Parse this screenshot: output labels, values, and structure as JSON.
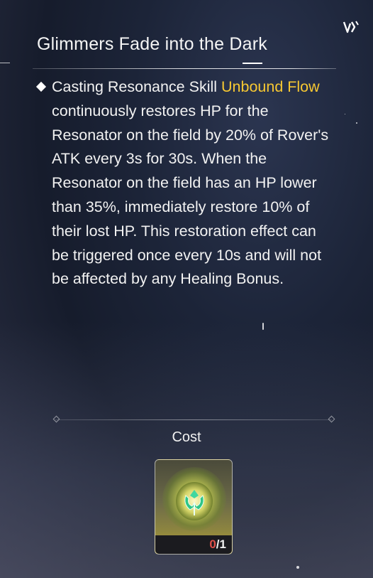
{
  "skill": {
    "title": "Glimmers Fade into the Dark",
    "description_before": "Casting Resonance Skill ",
    "highlight": "Unbound Flow",
    "description_after": " continuously restores HP for the Resonator on the field by 20% of Rover's ATK every 3s for 30s. When the Resonator on the field has an HP lower than 35%, immediately restore 10% of their lost HP. This restoration effect can be triggered once every 10s and will not be affected by any Healing Bonus."
  },
  "cost": {
    "label": "Cost",
    "item": {
      "icon": "spectro-emblem-icon",
      "owned": "0",
      "separator": "/",
      "required": "1"
    }
  },
  "colors": {
    "highlight": "#f7c832",
    "owned_insufficient": "#e0504a"
  },
  "corner_icon": "rank-chevron-icon"
}
